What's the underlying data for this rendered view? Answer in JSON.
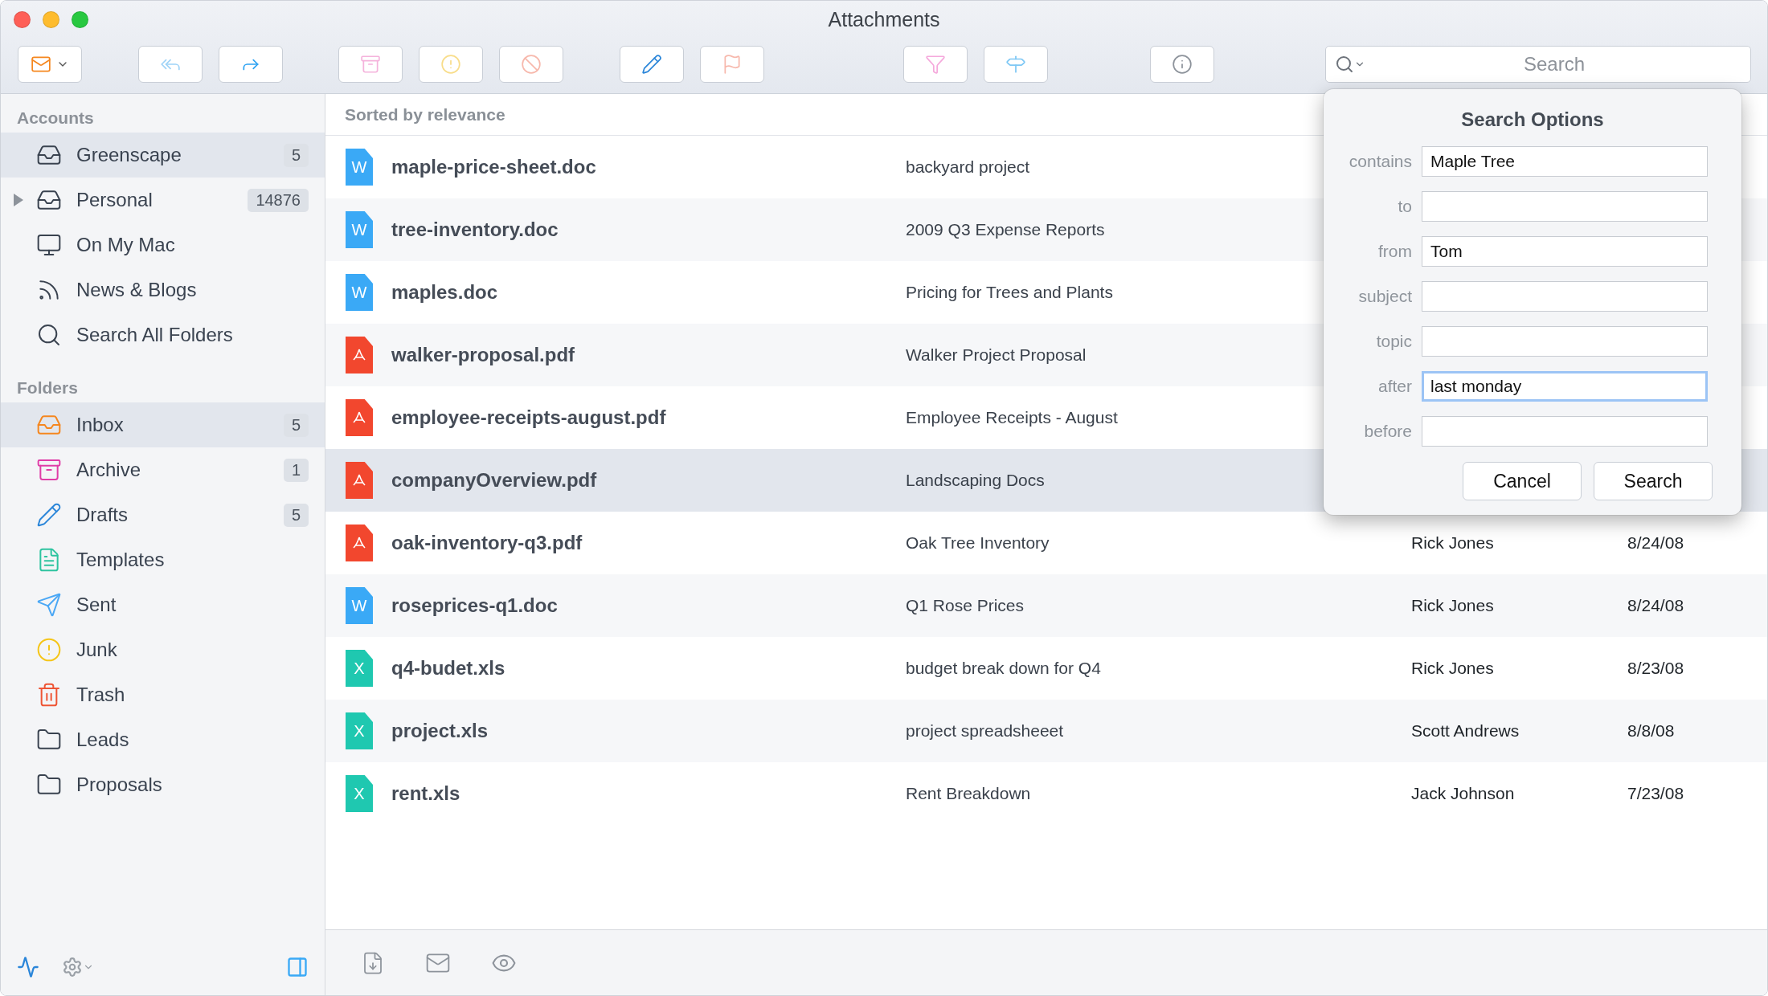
{
  "window": {
    "title": "Attachments"
  },
  "toolbar": {
    "search": {
      "placeholder": "Search"
    }
  },
  "sidebar": {
    "sections": [
      {
        "heading": "Accounts",
        "items": [
          {
            "label": "Greenscape",
            "count": "5",
            "selected": true
          },
          {
            "label": "Personal",
            "count": "14876",
            "selected": false,
            "expanded": false
          },
          {
            "label": "On My Mac",
            "selected": false
          },
          {
            "label": "News & Blogs",
            "selected": false
          },
          {
            "label": "Search All Folders",
            "selected": false
          }
        ]
      },
      {
        "heading": "Folders",
        "items": [
          {
            "label": "Inbox",
            "count": "5",
            "selected": true
          },
          {
            "label": "Archive",
            "count": "1",
            "selected": false
          },
          {
            "label": "Drafts",
            "count": "5",
            "selected": false
          },
          {
            "label": "Templates",
            "selected": false
          },
          {
            "label": "Sent",
            "selected": false
          },
          {
            "label": "Junk",
            "selected": false
          },
          {
            "label": "Trash",
            "selected": false
          },
          {
            "label": "Leads",
            "selected": false
          },
          {
            "label": "Proposals",
            "selected": false
          }
        ]
      }
    ]
  },
  "list": {
    "sort_label": "Sorted by relevance",
    "rows": [
      {
        "kind": "doc",
        "badge": "W",
        "name": "maple-price-sheet.doc",
        "subject": "backyard project",
        "selected": false
      },
      {
        "kind": "doc",
        "badge": "W",
        "name": "tree-inventory.doc",
        "subject": "2009 Q3 Expense Reports",
        "selected": false
      },
      {
        "kind": "doc",
        "badge": "W",
        "name": "maples.doc",
        "subject": "Pricing for Trees and Plants",
        "selected": false
      },
      {
        "kind": "pdf",
        "name": "walker-proposal.pdf",
        "subject": "Walker Project Proposal",
        "selected": false
      },
      {
        "kind": "pdf",
        "name": "employee-receipts-august.pdf",
        "subject": "Employee Receipts - August",
        "selected": false
      },
      {
        "kind": "pdf",
        "name": "companyOverview.pdf",
        "subject": "Landscaping Docs",
        "selected": true
      },
      {
        "kind": "pdf",
        "name": "oak-inventory-q3.pdf",
        "subject": "Oak Tree Inventory",
        "sender": "Rick Jones",
        "date": "8/24/08",
        "selected": false
      },
      {
        "kind": "doc",
        "badge": "W",
        "name": "roseprices-q1.doc",
        "subject": "Q1 Rose Prices",
        "sender": "Rick Jones",
        "date": "8/24/08",
        "selected": false
      },
      {
        "kind": "xls",
        "badge": "X",
        "name": "q4-budet.xls",
        "subject": "budget break down for Q4",
        "sender": "Rick Jones",
        "date": "8/23/08",
        "selected": false
      },
      {
        "kind": "xls",
        "badge": "X",
        "name": "project.xls",
        "subject": "project spreadsheeet",
        "sender": "Scott Andrews",
        "date": "8/8/08",
        "selected": false
      },
      {
        "kind": "xls",
        "badge": "X",
        "name": "rent.xls",
        "subject": "Rent Breakdown",
        "sender": "Jack Johnson",
        "date": "7/23/08",
        "selected": false
      }
    ]
  },
  "search_options": {
    "title": "Search Options",
    "fields": [
      {
        "label": "contains",
        "value": "Maple Tree",
        "focused": false
      },
      {
        "label": "to",
        "focused": false
      },
      {
        "label": "from",
        "value": "Tom",
        "focused": false
      },
      {
        "label": "subject",
        "focused": false
      },
      {
        "label": "topic",
        "focused": false
      },
      {
        "label": "after",
        "value": "last monday",
        "focused": true
      },
      {
        "label": "before",
        "focused": false
      }
    ],
    "buttons": [
      "Cancel",
      "Search"
    ]
  }
}
